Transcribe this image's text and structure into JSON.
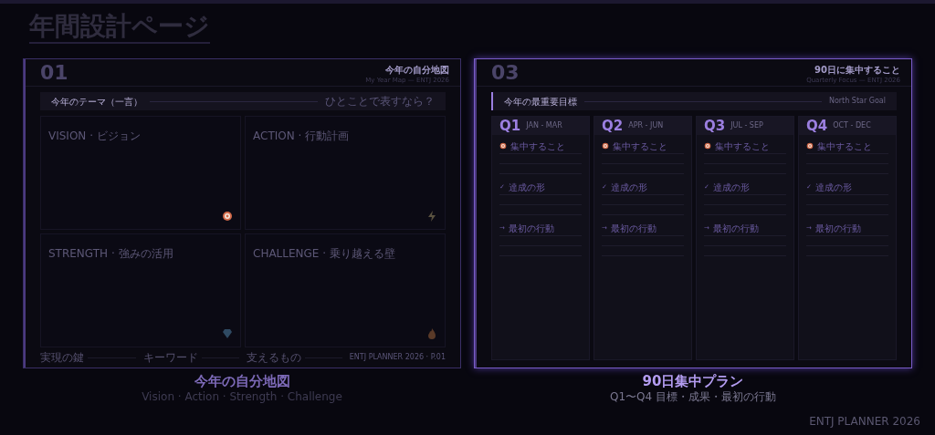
{
  "page_title": "年間設計ページ",
  "cards": [
    {
      "kind": "map",
      "selected": false,
      "number": "01",
      "title": "今年の自分地図",
      "subtitle": "My Year Map — ENTJ 2026",
      "theme": {
        "label": "今年のテーマ（一言）",
        "hint": "ひとことで表すなら？"
      },
      "quadrants": [
        {
          "label": "VISION · ビジョン"
        },
        {
          "label": "ACTION · 行動計画"
        },
        {
          "label": "STRENGTH · 強みの活用"
        },
        {
          "label": "CHALLENGE · 乗り越える壁"
        }
      ],
      "footer": {
        "fields": [
          "実現の鍵",
          "キーワード",
          "支えるもの"
        ],
        "page": "ENTJ PLANNER 2026 · P.01"
      },
      "caption": "今年の自分地図",
      "caption_sub": "Vision · Action · Strength · Challenge"
    },
    {
      "kind": "quarters",
      "selected": true,
      "number": "03",
      "title": "90日に集中すること",
      "subtitle": "Quarterly Focus — ENTJ 2026",
      "goal": {
        "label": "今年の最重要目標",
        "hint": "North Star Goal"
      },
      "quarters": [
        {
          "name": "Q1",
          "months": "JAN - MAR",
          "sections": [
            {
              "label": "集中すること"
            },
            {
              "marker": "✓",
              "label": "達成の形"
            },
            {
              "marker": "→",
              "label": "最初の行動"
            }
          ]
        },
        {
          "name": "Q2",
          "months": "APR - JUN",
          "sections": [
            {
              "label": "集中すること"
            },
            {
              "marker": "✓",
              "label": "達成の形"
            },
            {
              "marker": "→",
              "label": "最初の行動"
            }
          ]
        },
        {
          "name": "Q3",
          "months": "JUL - SEP",
          "sections": [
            {
              "label": "集中すること"
            },
            {
              "marker": "✓",
              "label": "達成の形"
            },
            {
              "marker": "→",
              "label": "最初の行動"
            }
          ]
        },
        {
          "name": "Q4",
          "months": "OCT - DEC",
          "sections": [
            {
              "label": "集中すること"
            },
            {
              "marker": "✓",
              "label": "達成の形"
            },
            {
              "marker": "→",
              "label": "最初の行動"
            }
          ]
        }
      ],
      "caption": "90日集中プラン",
      "caption_sub": "Q1〜Q4 目標・成果・最初の行動"
    }
  ],
  "brand": "ENTJ PLANNER 2026"
}
